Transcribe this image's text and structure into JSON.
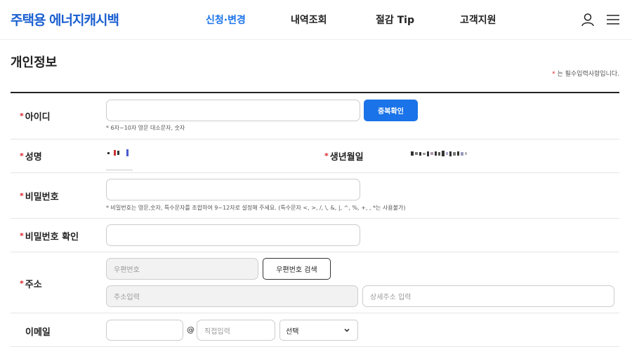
{
  "header": {
    "logo": "주택용 에너지캐시백",
    "nav": [
      {
        "label": "신청·변경",
        "active": true
      },
      {
        "label": "내역조회",
        "active": false
      },
      {
        "label": "절감 Tip",
        "active": false
      },
      {
        "label": "고객지원",
        "active": false
      }
    ],
    "icons": [
      "user-icon",
      "menu-icon"
    ]
  },
  "page": {
    "title": "개인정보",
    "required_note": "* 는 필수입력사항입니다."
  },
  "form": {
    "id": {
      "label": "아이디",
      "required_mark": "*",
      "value": "",
      "check_button": "중복확인",
      "hint": "* 6자~10자 영문 대소문자, 숫자"
    },
    "name": {
      "label": "성명",
      "required_mark": "*"
    },
    "birth": {
      "label": "생년월일",
      "required_mark": "*"
    },
    "password": {
      "label": "비밀번호",
      "required_mark": "*",
      "value": "",
      "hint": "* 비밀번호는 영문,숫자, 특수문자를 조합하여 9~12자로 설정해 주세요. (특수문자 <, >, /, \\, &, |, ^, %, +, , *는 사용불가)"
    },
    "password_confirm": {
      "label": "비밀번호 확인",
      "required_mark": "*",
      "value": ""
    },
    "address": {
      "label": "주소",
      "required_mark": "*",
      "zipcode_placeholder": "우편번호",
      "search_button": "우편번호 검색",
      "address_placeholder": "주소입력",
      "detail_placeholder": "상세주소 입력"
    },
    "email": {
      "label": "이메일",
      "at": "@",
      "domain_placeholder": "직접입력",
      "select_value": "선택"
    }
  },
  "colors": {
    "accent": "#1a73e8",
    "required": "#d9262c",
    "logo": "#1a5fd0"
  }
}
